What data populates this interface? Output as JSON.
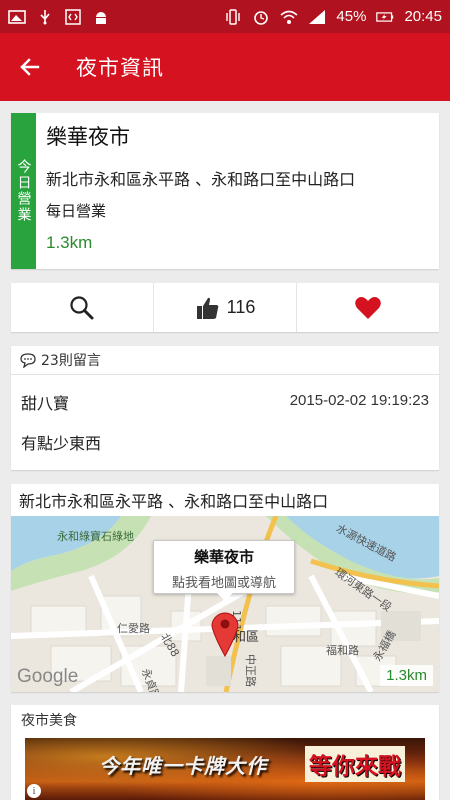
{
  "status_bar": {
    "battery": "45%",
    "time": "20:45",
    "icons": [
      "gallery-icon",
      "usb-icon",
      "developer-icon",
      "android-icon",
      "vibrate-icon",
      "alarm-icon",
      "wifi-icon",
      "signal-icon",
      "battery-charging-icon"
    ]
  },
  "toolbar": {
    "title": "夜市資訊",
    "back_icon": "arrow-back-icon"
  },
  "info": {
    "status": "今日營業",
    "name": "樂華夜市",
    "address": "新北市永和區永平路 、永和路口至中山路口",
    "hours": "每日營業",
    "distance": "1.3km",
    "status_color": "#29a33e"
  },
  "actions": {
    "like_count": "116",
    "icons": [
      "search-icon",
      "thumbs-up-icon",
      "heart-icon"
    ]
  },
  "comments": {
    "count_label": "23則留言",
    "author": "甜八寶",
    "time": "2015-02-02 19:19:23",
    "text": "有點少東西"
  },
  "map": {
    "address": "新北市永和區永平路 、永和路口至中山路口",
    "bubble_title": "樂華夜市",
    "bubble_subtitle": "點我看地圖或導航",
    "distance": "1.3km",
    "provider": "Google",
    "labels": {
      "park": "永和綠寶石綠地",
      "expressway": "水源快速道路",
      "road1": "環河東路一段",
      "road2": "仁愛路",
      "road3": "北88",
      "road4": "和區",
      "road5": "中正路",
      "road6": "福和路",
      "road7": "永福橋",
      "road8": "永貞路",
      "road9": "111"
    }
  },
  "food": {
    "header": "夜市美食",
    "banner_a": "今年唯一卡牌大作",
    "banner_b": "等你來戰"
  },
  "colors": {
    "primary": "#d5121f",
    "status_bar": "#b0121f",
    "accent_green": "#2a8a2e",
    "heart": "#d5121f"
  }
}
